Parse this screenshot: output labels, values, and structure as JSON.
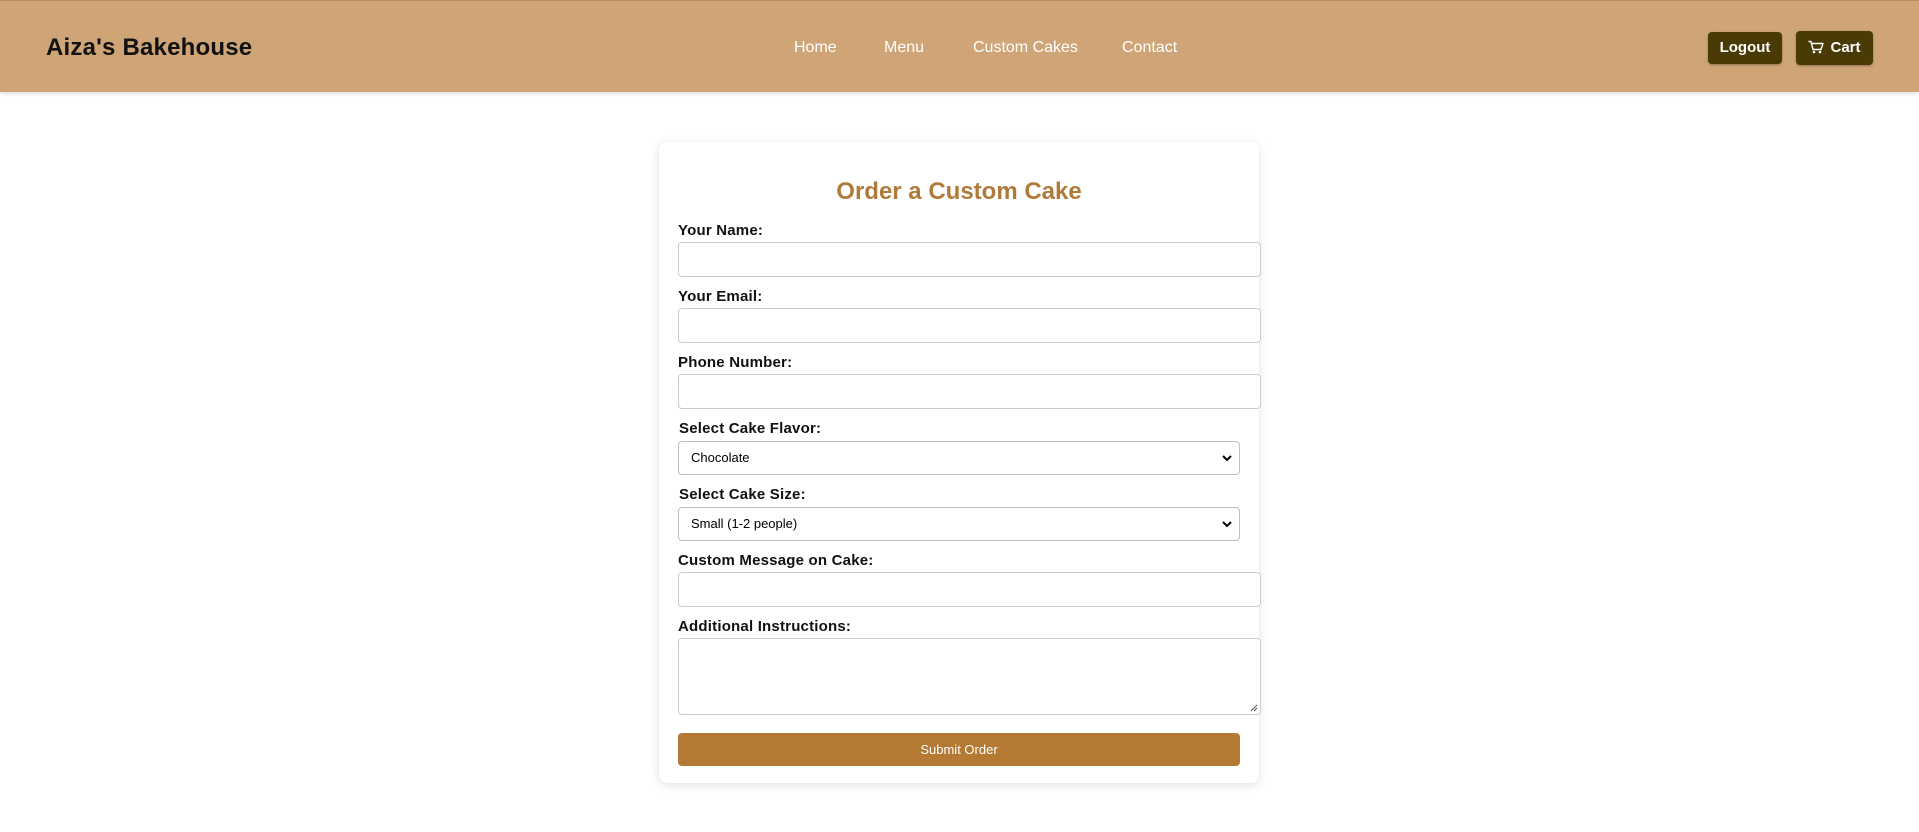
{
  "header": {
    "brand": "Aiza's Bakehouse",
    "nav": [
      "Home",
      "Menu",
      "Custom Cakes",
      "Contact"
    ],
    "logout_label": "Logout",
    "cart_label": "Cart",
    "cart_icon": "shopping-cart-icon"
  },
  "form": {
    "title": "Order a Custom Cake",
    "name_label": "Your Name:",
    "name_value": "",
    "email_label": "Your Email:",
    "email_value": "",
    "phone_label": "Phone Number:",
    "phone_value": "",
    "flavor_label": "Select Cake Flavor:",
    "flavor_selected": "Chocolate",
    "size_label": "Select Cake Size:",
    "size_selected": "Small (1-2 people)",
    "message_label": "Custom Message on Cake:",
    "message_value": "",
    "instructions_label": "Additional Instructions:",
    "instructions_value": "",
    "submit_label": "Submit Order"
  },
  "colors": {
    "header_bg": "#cfa577",
    "dark_button": "#4a3a05",
    "title_color": "#b07a3a",
    "submit_bg": "#b47a33"
  }
}
